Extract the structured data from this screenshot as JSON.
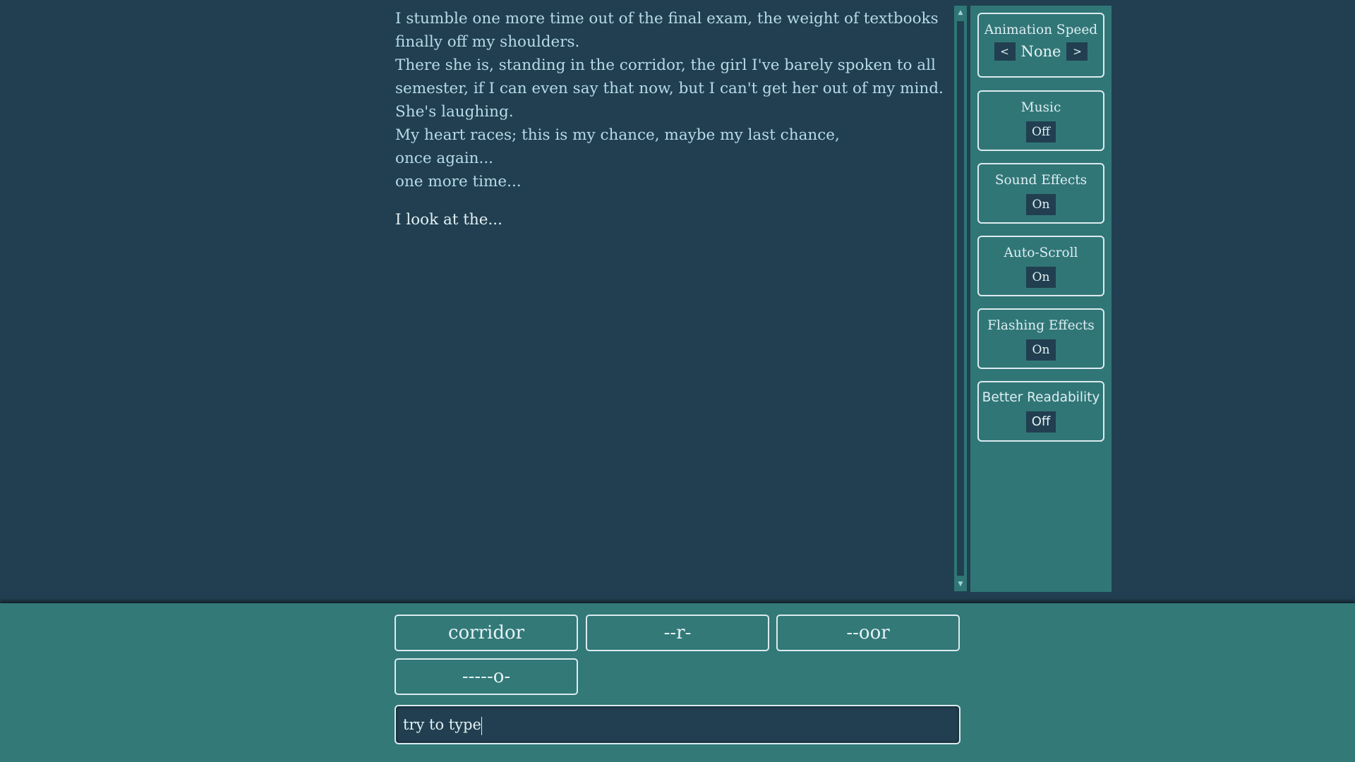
{
  "story": {
    "lines": [
      "I stumble one more time out of the final exam, the weight of textbooks finally off my shoulders.",
      "There she is, standing in the corridor, the girl I've barely spoken to all semester, if I can even say that now, but I can't get her out of my mind.",
      "She's laughing.",
      "My heart races; this is my chance, maybe my last chance,",
      "once again...",
      "one more time..."
    ],
    "prompt": "I look at the..."
  },
  "scrollbar": {
    "up_icon": "▲",
    "down_icon": "▼"
  },
  "settings": {
    "animation_speed": {
      "title": "Animation Speed",
      "prev": "<",
      "value": "None",
      "next": ">"
    },
    "music": {
      "title": "Music",
      "value": "Off"
    },
    "sound_effects": {
      "title": "Sound Effects",
      "value": "On"
    },
    "auto_scroll": {
      "title": "Auto-Scroll",
      "value": "On"
    },
    "flashing_effects": {
      "title": "Flashing Effects",
      "value": "On"
    },
    "better_readability": {
      "title": "Better Readability",
      "value": "Off"
    }
  },
  "choices": [
    "corridor",
    "--r-",
    "--oor",
    "-----o-"
  ],
  "input": {
    "value": "try to type"
  },
  "colors": {
    "background": "#213f50",
    "panel": "#317677",
    "bottom_bar": "#327978",
    "text": "#b6dbe8"
  }
}
